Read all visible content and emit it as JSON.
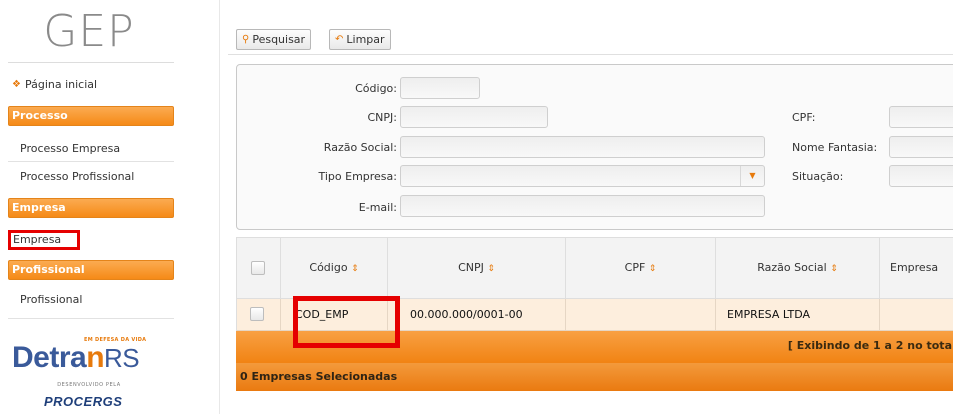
{
  "sidebar": {
    "logo": "GEP",
    "home": "Página inicial",
    "sections": [
      {
        "title": "Processo",
        "items": [
          "Processo Empresa",
          "Processo Profissional"
        ]
      },
      {
        "title": "Empresa",
        "items": [
          "Empresa"
        ]
      },
      {
        "title": "Profissional",
        "items": [
          "Profissional"
        ]
      }
    ],
    "detran": {
      "tagline": "EM DEFESA DA VIDA",
      "name_a": "Detra",
      "name_n": "n",
      "name_rs": "RS"
    },
    "developed_by": "DESENVOLVIDO PELA",
    "procergs": "PROCERGS"
  },
  "toolbar": {
    "search_label": "Pesquisar",
    "clear_label": "Limpar"
  },
  "filters": {
    "codigo": "Código:",
    "cnpj": "CNPJ:",
    "cpf": "CPF:",
    "razao_social": "Razão Social:",
    "nome_fantasia": "Nome Fantasia:",
    "tipo_empresa": "Tipo Empresa:",
    "situacao": "Situação:",
    "email": "E-mail:"
  },
  "table": {
    "columns": [
      "Código",
      "CNPJ",
      "CPF",
      "Razão Social",
      "Empresa"
    ],
    "rows": [
      {
        "codigo": "COD_EMP",
        "cnpj": "00.000.000/0001-00",
        "cpf": "",
        "razao_social": "EMPRESA LTDA"
      }
    ],
    "pager": "[ Exibindo de 1 a 2 no tota",
    "selected": "0 Empresas Selecionadas"
  },
  "colors": {
    "accent": "#f58a17",
    "highlight": "#e50000",
    "row_selected": "#fdeedd"
  }
}
